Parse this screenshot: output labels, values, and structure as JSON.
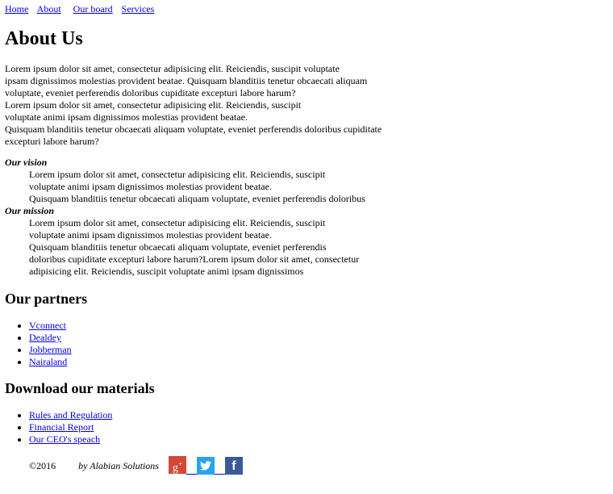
{
  "nav": [
    "Home",
    "About",
    "Our board",
    "Services"
  ],
  "title": "About Us",
  "intro": [
    "Lorem ipsum dolor sit amet, consectetur adipisicing elit. Reiciendis, suscipit voluptate",
    "ipsam dignissimos molestias provident beatae. Quisquam blanditiis tenetur obcaecati aliquam",
    "voluptate, eveniet perferendis doloribus cupiditate excepturi labore harum?",
    "Lorem ipsum dolor sit amet, consectetur adipisicing elit. Reiciendis, suscipit",
    "voluptate animi ipsam dignissimos molestias provident beatae.",
    "Quisquam blanditiis tenetur obcaecati aliquam voluptate, eveniet perferendis doloribus cupiditate",
    "excepturi labore harum?"
  ],
  "vision": {
    "term": "Our vision",
    "lines": [
      "Lorem ipsum dolor sit amet, consectetur adipisicing elit. Reiciendis, suscipit",
      "voluptate animi ipsam dignissimos molestias provident beatae.",
      "Quisquam blanditiis tenetur obcaecati aliquam voluptate, eveniet perferendis doloribus"
    ]
  },
  "mission": {
    "term": "Our mission",
    "lines": [
      "Lorem ipsum dolor sit amet, consectetur adipisicing elit. Reiciendis, suscipit",
      "voluptate animi ipsam dignissimos molestias provident beatae.",
      "Quisquam blanditiis tenetur obcaecati aliquam voluptate, eveniet perferendis",
      "doloribus cupiditate excepturi labore harum?Lorem ipsum dolor sit amet, consectetur",
      "adipisicing elit. Reiciendis, suscipit voluptate animi ipsam dignissimos"
    ]
  },
  "partners": {
    "heading": "Our partners",
    "items": [
      "Vconnect",
      "Dealdey",
      "Jobberman",
      "Nairaland"
    ]
  },
  "materials": {
    "heading": "Download our materials",
    "items": [
      "Rules and Regulation",
      "Financial Report",
      "Our CEO's speach"
    ]
  },
  "footer": {
    "copyright": "©2016",
    "by": "by Alabian Solutions",
    "social": [
      {
        "icon": "google-plus-icon",
        "glyph": "g+",
        "color": "#d34836"
      },
      {
        "icon": "twitter-icon",
        "glyph": "🐦",
        "color": "#2aa3ef"
      },
      {
        "icon": "facebook-icon",
        "glyph": "f",
        "color": "#3b5998"
      }
    ]
  }
}
